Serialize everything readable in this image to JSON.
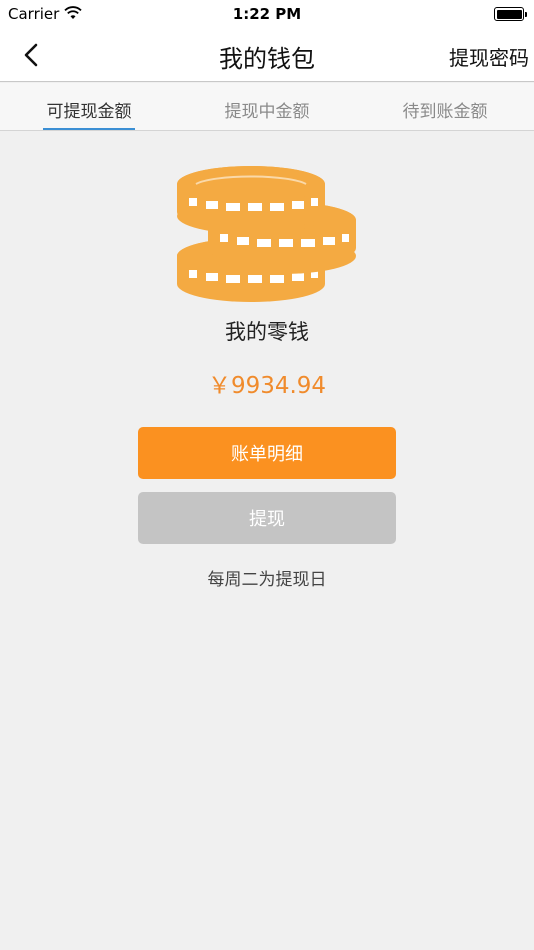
{
  "status_bar": {
    "carrier": "Carrier",
    "time": "1:22 PM"
  },
  "nav": {
    "title": "我的钱包",
    "right_button": "提现密码"
  },
  "tabs": [
    {
      "label": "可提现金额",
      "active": true
    },
    {
      "label": "提现中金额",
      "active": false
    },
    {
      "label": "待到账金额",
      "active": false
    }
  ],
  "wallet": {
    "label": "我的零钱",
    "amount": "￥9934.94"
  },
  "buttons": {
    "details": "账单明细",
    "withdraw": "提现"
  },
  "note": "每周二为提现日",
  "colors": {
    "accent_orange": "#fb9120",
    "amount_orange": "#f08b2c",
    "coin_gold": "#f4aa42",
    "disabled_gray": "#c4c4c4",
    "tab_underline": "#3b8fd4"
  },
  "icons": [
    "back-chevron-icon",
    "wifi-icon",
    "battery-icon",
    "coins-stack-icon"
  ]
}
